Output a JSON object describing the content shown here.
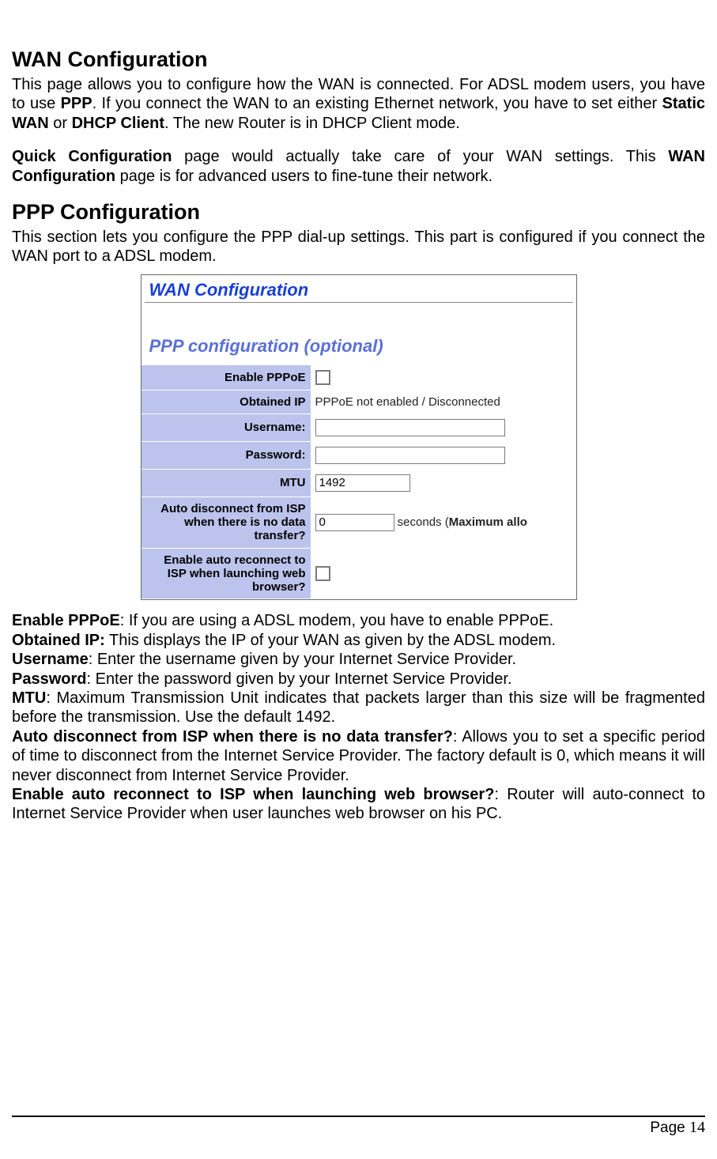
{
  "sections": {
    "wan": {
      "heading": "WAN Configuration",
      "para1_a": "This page allows you to configure how the WAN is connected. For ADSL modem users, you have to use ",
      "para1_b_bold": "PPP",
      "para1_c": ". If you connect the WAN to an existing Ethernet network, you have to set either ",
      "para1_d_bold": "Static WAN",
      "para1_e": " or ",
      "para1_f_bold": "DHCP Client",
      "para1_g": ". The new Router is in DHCP Client mode.",
      "para2_a_bold": "Quick Configuration",
      "para2_b": " page would actually take care of your WAN settings. This ",
      "para2_c_bold": "WAN Configuration",
      "para2_d": " page is for advanced users to fine-tune their network."
    },
    "ppp": {
      "heading": "PPP Configuration",
      "intro": "This section lets you configure the PPP dial-up settings. This part is configured if you connect the WAN port to a ADSL modem."
    }
  },
  "screenshot": {
    "title_main": "WAN Configuration",
    "title_sub": "PPP configuration (optional)",
    "rows": {
      "enable_pppoe": {
        "label": "Enable PPPoE"
      },
      "obtained_ip": {
        "label": "Obtained IP",
        "value": "PPPoE not enabled / Disconnected"
      },
      "username": {
        "label": "Username:",
        "value": ""
      },
      "password": {
        "label": "Password:",
        "value": ""
      },
      "mtu": {
        "label": "MTU",
        "value": "1492"
      },
      "auto_disc": {
        "label": "Auto disconnect from ISP when there is no data transfer?",
        "value": "0",
        "suffix_a": " seconds (",
        "suffix_b_bold": "Maximum allo"
      },
      "auto_recon": {
        "label": "Enable auto reconnect to ISP when launching web browser?"
      }
    }
  },
  "defs": {
    "enable_pppoe": {
      "t": "Enable PPPoE",
      "d": ": If you are using a ADSL modem, you have to enable PPPoE."
    },
    "obtained_ip": {
      "t": "Obtained IP:",
      "d": " This displays the IP of your WAN as given by the ADSL modem."
    },
    "username": {
      "t": "Username",
      "d": ": Enter the username given by your Internet Service Provider."
    },
    "password": {
      "t": "Password",
      "d": ": Enter the password given by your Internet Service Provider."
    },
    "mtu": {
      "t": "MTU",
      "d": ": Maximum Transmission Unit indicates that packets larger than this size will be fragmented before the transmission. Use the default 1492."
    },
    "auto_disc": {
      "t": "Auto disconnect from ISP when there is no data transfer?",
      "d": ": Allows you to set a specific period of time to disconnect from the Internet Service Provider. The factory default is 0, which means it will never disconnect from Internet Service Provider."
    },
    "auto_recon": {
      "t": "Enable auto reconnect to ISP when launching web browser?",
      "d": ": Router will auto-connect to Internet Service Provider when user launches web browser on his PC."
    }
  },
  "footer": {
    "label": "Page ",
    "number": "14"
  }
}
